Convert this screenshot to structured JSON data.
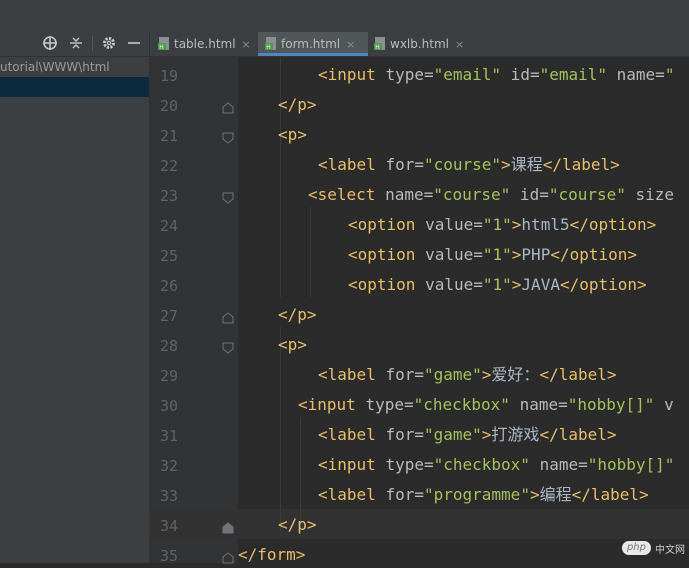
{
  "sidebar": {
    "path": "utorial\\WWW\\html",
    "tools": [
      "crosshair-icon",
      "collapse-icon",
      "gear-icon",
      "hide-icon"
    ]
  },
  "tabs": [
    {
      "label": "table.html",
      "active": false
    },
    {
      "label": "form.html",
      "active": true
    },
    {
      "label": "wxlb.html",
      "active": false
    }
  ],
  "close_glyph": "×",
  "editor": {
    "current_line": 34,
    "lines": [
      {
        "num": "19",
        "segs": [
          [
            "p",
            "<"
          ],
          [
            "t",
            "input"
          ],
          [
            "a",
            " type="
          ],
          [
            "v",
            "\"email\""
          ],
          [
            "a",
            " id="
          ],
          [
            "v",
            "\"email\""
          ],
          [
            "a",
            " name="
          ],
          [
            "v",
            "\""
          ]
        ]
      },
      {
        "num": "20",
        "segs": [
          [
            "p",
            "</"
          ],
          [
            "t",
            "p"
          ],
          [
            "p",
            ">"
          ]
        ]
      },
      {
        "num": "21",
        "segs": [
          [
            "p",
            "<"
          ],
          [
            "t",
            "p"
          ],
          [
            "p",
            ">"
          ]
        ]
      },
      {
        "num": "22",
        "segs": [
          [
            "p",
            "<"
          ],
          [
            "t",
            "label"
          ],
          [
            "a",
            " for="
          ],
          [
            "v",
            "\"course\""
          ],
          [
            "p",
            ">"
          ],
          [
            "x",
            "课程"
          ],
          [
            "p",
            "</"
          ],
          [
            "t",
            "label"
          ],
          [
            "p",
            ">"
          ]
        ]
      },
      {
        "num": "23",
        "segs": [
          [
            "p",
            "<"
          ],
          [
            "t",
            "select"
          ],
          [
            "a",
            " name="
          ],
          [
            "v",
            "\"course\""
          ],
          [
            "a",
            " id="
          ],
          [
            "v",
            "\"course\""
          ],
          [
            "a",
            " size"
          ]
        ]
      },
      {
        "num": "24",
        "segs": [
          [
            "p",
            "<"
          ],
          [
            "t",
            "option"
          ],
          [
            "a",
            " value="
          ],
          [
            "v",
            "\"1\""
          ],
          [
            "p",
            ">"
          ],
          [
            "x",
            "html5"
          ],
          [
            "p",
            "</"
          ],
          [
            "t",
            "option"
          ],
          [
            "p",
            ">"
          ]
        ]
      },
      {
        "num": "25",
        "segs": [
          [
            "p",
            "<"
          ],
          [
            "t",
            "option"
          ],
          [
            "a",
            " value="
          ],
          [
            "v",
            "\"1\""
          ],
          [
            "p",
            ">"
          ],
          [
            "x",
            "PHP"
          ],
          [
            "p",
            "</"
          ],
          [
            "t",
            "option"
          ],
          [
            "p",
            ">"
          ]
        ]
      },
      {
        "num": "26",
        "segs": [
          [
            "p",
            "<"
          ],
          [
            "t",
            "option"
          ],
          [
            "a",
            " value="
          ],
          [
            "v",
            "\"1\""
          ],
          [
            "p",
            ">"
          ],
          [
            "x",
            "JAVA"
          ],
          [
            "p",
            "</"
          ],
          [
            "t",
            "option"
          ],
          [
            "p",
            ">"
          ]
        ]
      },
      {
        "num": "27",
        "segs": [
          [
            "p",
            "</"
          ],
          [
            "t",
            "p"
          ],
          [
            "p",
            ">"
          ]
        ]
      },
      {
        "num": "28",
        "segs": [
          [
            "p",
            "<"
          ],
          [
            "t",
            "p"
          ],
          [
            "p",
            ">"
          ]
        ]
      },
      {
        "num": "29",
        "segs": [
          [
            "p",
            "<"
          ],
          [
            "t",
            "label"
          ],
          [
            "a",
            " for="
          ],
          [
            "v",
            "\"game\""
          ],
          [
            "p",
            ">"
          ],
          [
            "x",
            "爱好："
          ],
          [
            "p",
            "</"
          ],
          [
            "t",
            "label"
          ],
          [
            "p",
            ">"
          ]
        ]
      },
      {
        "num": "30",
        "segs": [
          [
            "p",
            "<"
          ],
          [
            "t",
            "input"
          ],
          [
            "a",
            " type="
          ],
          [
            "v",
            "\"checkbox\""
          ],
          [
            "a",
            " name="
          ],
          [
            "v",
            "\"hobby[]\""
          ],
          [
            "a",
            " v"
          ]
        ]
      },
      {
        "num": "31",
        "segs": [
          [
            "p",
            "<"
          ],
          [
            "t",
            "label"
          ],
          [
            "a",
            " for="
          ],
          [
            "v",
            "\"game\""
          ],
          [
            "p",
            ">"
          ],
          [
            "x",
            "打游戏"
          ],
          [
            "p",
            "</"
          ],
          [
            "t",
            "label"
          ],
          [
            "p",
            ">"
          ]
        ]
      },
      {
        "num": "32",
        "segs": [
          [
            "p",
            "<"
          ],
          [
            "t",
            "input"
          ],
          [
            "a",
            " type="
          ],
          [
            "v",
            "\"checkbox\""
          ],
          [
            "a",
            " name="
          ],
          [
            "v",
            "\"hobby[]\""
          ]
        ]
      },
      {
        "num": "33",
        "segs": [
          [
            "p",
            "<"
          ],
          [
            "t",
            "label"
          ],
          [
            "a",
            " for="
          ],
          [
            "v",
            "\"programme\""
          ],
          [
            "p",
            ">"
          ],
          [
            "x",
            "编程"
          ],
          [
            "p",
            "</"
          ],
          [
            "t",
            "label"
          ],
          [
            "p",
            ">"
          ]
        ]
      },
      {
        "num": "34",
        "segs": [
          [
            "p",
            "</"
          ],
          [
            "t",
            "p"
          ],
          [
            "p",
            ">"
          ]
        ]
      },
      {
        "num": "35",
        "segs": [
          [
            "p",
            "</"
          ],
          [
            "t",
            "form"
          ],
          [
            "p",
            ">"
          ]
        ]
      }
    ]
  },
  "watermark": {
    "badge": "php",
    "text": "中文网"
  }
}
